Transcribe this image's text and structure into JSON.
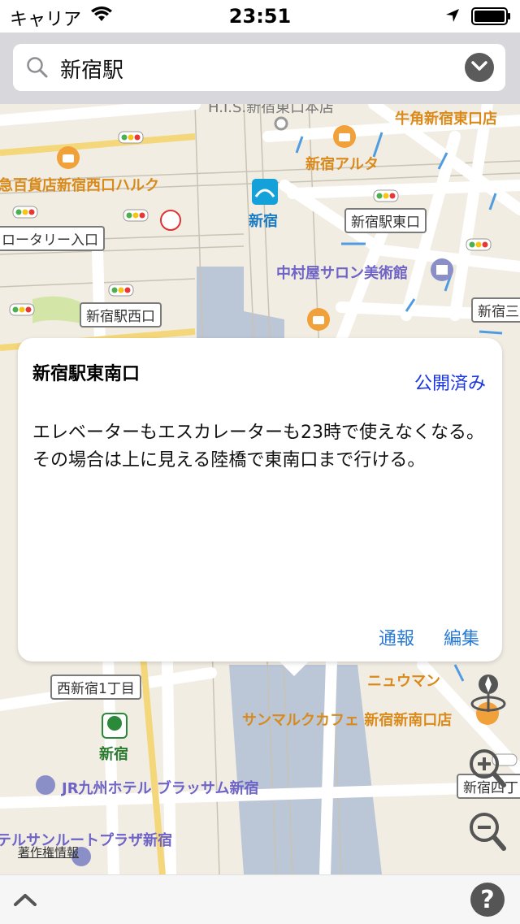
{
  "status_bar": {
    "carrier": "キャリア",
    "time": "23:51"
  },
  "search": {
    "query": "新宿駅"
  },
  "map_labels": {
    "his": "H.I.S.新宿東口本店",
    "gyukaku": "牛角新宿東口店",
    "odakyu_halc": "急百貨店新宿西口ハルク",
    "alta": "新宿アルタ",
    "metro_shinjuku": "新宿",
    "shinjuku_east": "新宿駅東口",
    "rotary": "ロータリー入口",
    "nakamuraya": "中村屋サロン美術館",
    "shinjuku_west": "新宿駅西口",
    "shinjuku_3": "新宿三",
    "nishishinjuku1": "西新宿1丁目",
    "newoman": "ニュウマン",
    "saint_marc": "サンマルクカフェ 新宿新南口店",
    "toei_shinjuku": "新宿",
    "jr_hotel": "JR九州ホテル ブラッサム新宿",
    "sunroute": "テルサンルートプラザ新宿",
    "shinjuku_4": "新宿四丁",
    "copyright": "著作権情報"
  },
  "callout": {
    "title": "新宿駅東南口",
    "status": "公開済み",
    "body": "エレベーターもエスカレーターも23時で使えなくなる。その場合は上に見える陸橋で東南口まで行ける。",
    "report_label": "通報",
    "edit_label": "編集"
  },
  "colors": {
    "link": "#2a7bd3",
    "status": "#1a34e0",
    "poi_orange": "#d98a1a",
    "poi_purple": "#6e63c6"
  }
}
